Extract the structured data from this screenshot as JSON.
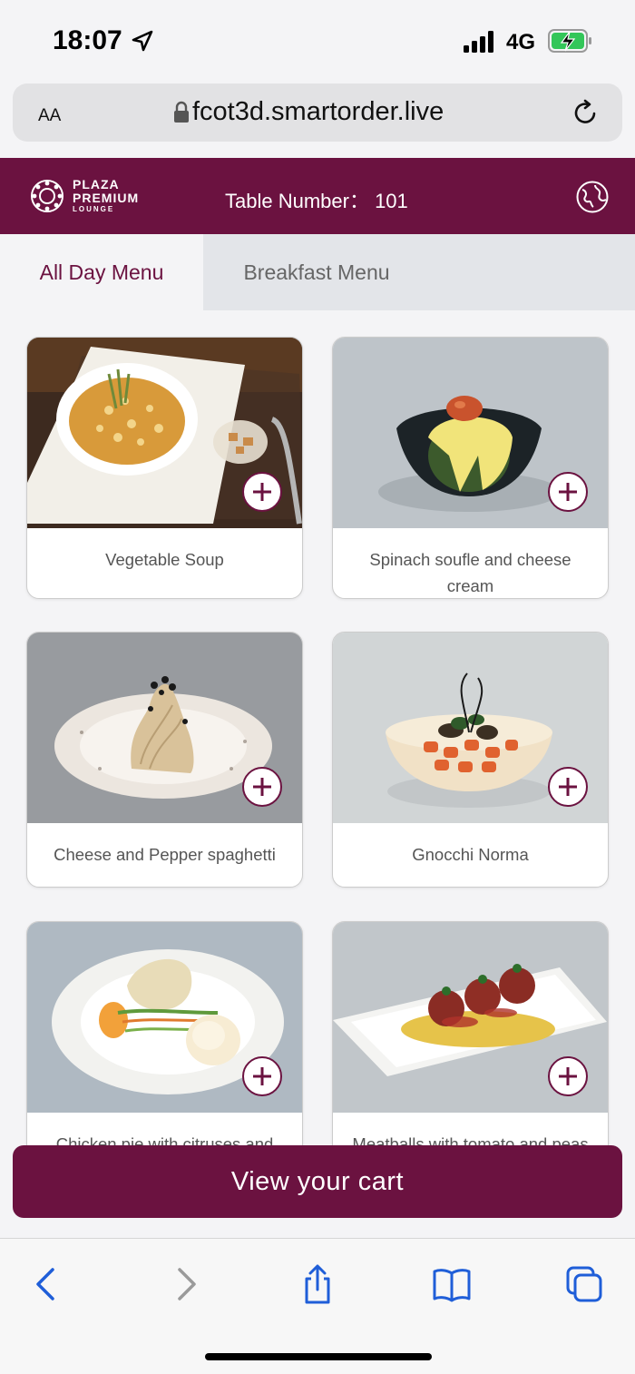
{
  "status_bar": {
    "time": "18:07",
    "network": "4G",
    "icons": [
      "location-arrow-icon",
      "signal-bars-icon",
      "battery-charging-icon"
    ]
  },
  "browser": {
    "text_size_label": "AA",
    "url": "fcot3d.smartorder.live",
    "icons": [
      "lock-icon",
      "reload-icon"
    ]
  },
  "header": {
    "brand_line1": "PLAZA",
    "brand_line2": "PREMIUM",
    "brand_line3": "LOUNGE",
    "table_number": "Table Number： 101",
    "icons": [
      "globe-icon"
    ],
    "color": "#6b1240"
  },
  "tabs": [
    {
      "label": "All Day Menu",
      "active": true
    },
    {
      "label": "Breakfast Menu",
      "active": false
    }
  ],
  "menu_items": [
    {
      "name": "Vegetable Soup"
    },
    {
      "name": "Spinach soufle and cheese cream"
    },
    {
      "name": "Cheese and Pepper spaghetti"
    },
    {
      "name": "Gnocchi Norma"
    },
    {
      "name": "Chicken pie with citruses and"
    },
    {
      "name": "Meatballs with tomato and peas"
    }
  ],
  "cart_button": {
    "label": "View your cart"
  },
  "toolbar": {
    "icons": [
      "back-icon",
      "forward-icon",
      "share-icon",
      "bookmarks-icon",
      "tabs-icon"
    ]
  }
}
